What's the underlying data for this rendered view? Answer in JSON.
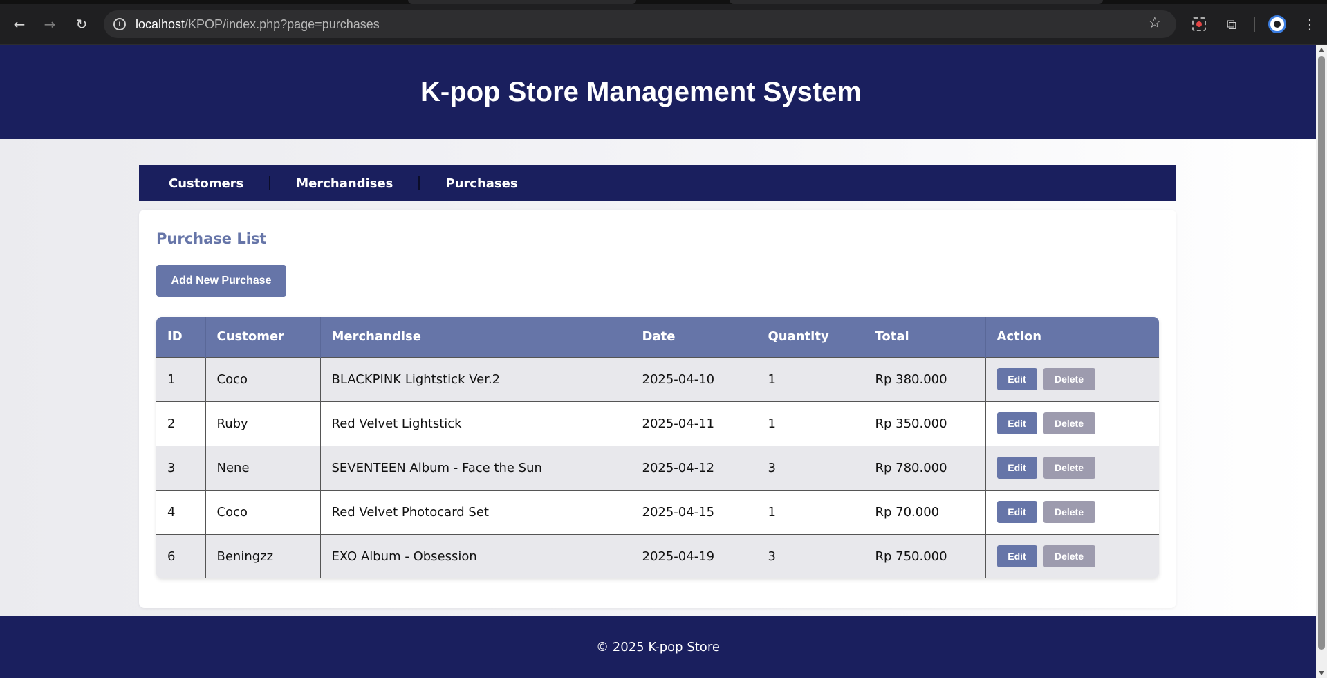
{
  "browser": {
    "url_host": "localhost",
    "url_path": "/KPOP/index.php?page=purchases"
  },
  "site": {
    "title": "K-pop Store Management System",
    "nav": [
      "Customers",
      "Merchandises",
      "Purchases"
    ],
    "footer": "© 2025 K-pop Store"
  },
  "purchases": {
    "heading": "Purchase List",
    "add_button": "Add New Purchase",
    "columns": [
      "ID",
      "Customer",
      "Merchandise",
      "Date",
      "Quantity",
      "Total",
      "Action"
    ],
    "edit_label": "Edit",
    "delete_label": "Delete",
    "rows": [
      {
        "id": "1",
        "customer": "Coco",
        "merchandise": "BLACKPINK Lightstick Ver.2",
        "date": "2025-04-10",
        "quantity": "1",
        "total": "Rp 380.000"
      },
      {
        "id": "2",
        "customer": "Ruby",
        "merchandise": "Red Velvet Lightstick",
        "date": "2025-04-11",
        "quantity": "1",
        "total": "Rp 350.000"
      },
      {
        "id": "3",
        "customer": "Nene",
        "merchandise": "SEVENTEEN Album - Face the Sun",
        "date": "2025-04-12",
        "quantity": "3",
        "total": "Rp 780.000"
      },
      {
        "id": "4",
        "customer": "Coco",
        "merchandise": "Red Velvet Photocard Set",
        "date": "2025-04-15",
        "quantity": "1",
        "total": "Rp 70.000"
      },
      {
        "id": "6",
        "customer": "Beningzz",
        "merchandise": "EXO Album - Obsession",
        "date": "2025-04-19",
        "quantity": "3",
        "total": "Rp 750.000"
      }
    ]
  },
  "colors": {
    "header_bg": "#1a1f5e",
    "accent": "#6675a8",
    "delete_button": "#9d9bae"
  },
  "icons": [
    "back-icon",
    "forward-icon",
    "reload-icon",
    "site-info-icon",
    "bookmark-star-icon",
    "screen-capture-icon",
    "extensions-icon",
    "profile-icon",
    "menu-icon"
  ]
}
